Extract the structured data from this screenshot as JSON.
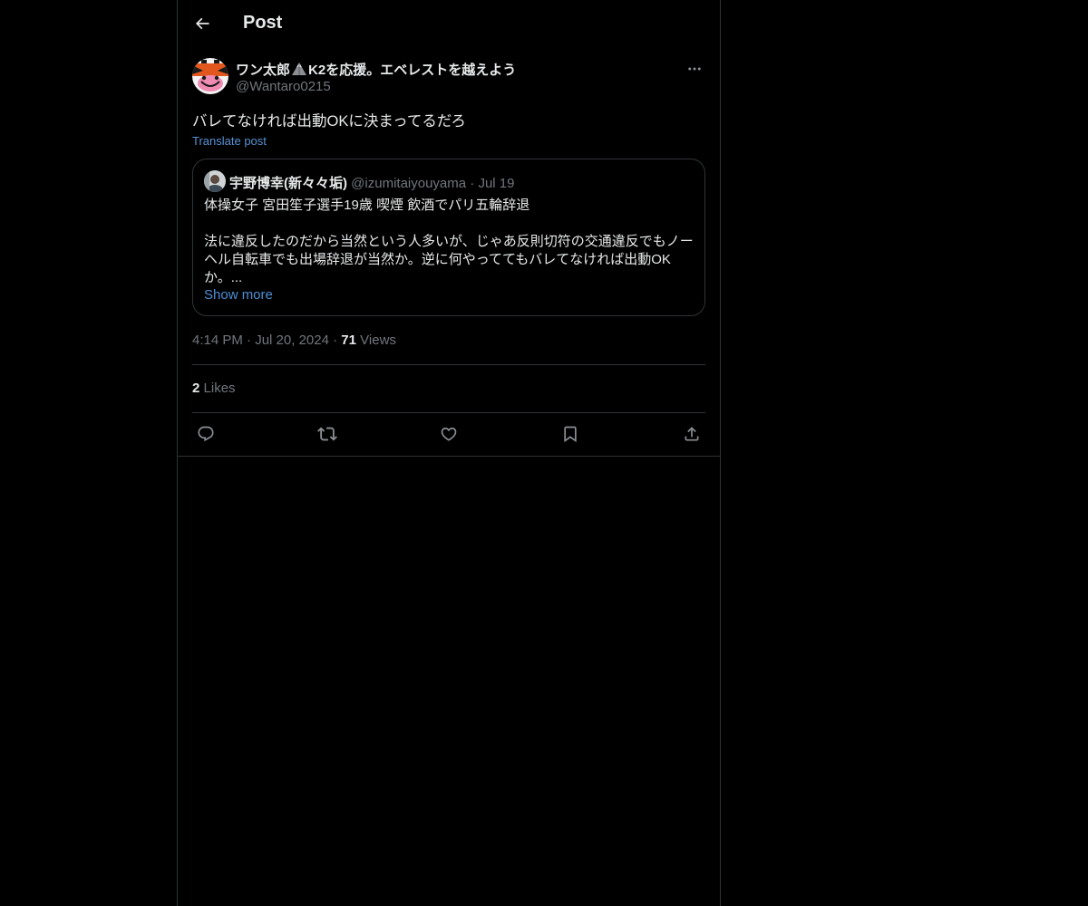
{
  "header": {
    "title": "Post"
  },
  "post": {
    "author": {
      "name_prefix": "ワン太郎",
      "name_suffix": "K2を応援。エベレストを越えよう",
      "handle": "@Wantaro0215"
    },
    "text": "バレてなければ出動OKに決まってるだろ",
    "translate_label": "Translate post",
    "quote": {
      "author_name": "宇野博幸(新々々垢)",
      "handle": "@izumitaiyouyama",
      "separator": "·",
      "date": "Jul 19",
      "line1": "体操女子 宮田笙子選手19歳 喫煙 飲酒でパリ五輪辞退",
      "line2": "法に違反したのだから当然という人多いが、じゃあ反則切符の交通違反でもノーヘル自転車でも出場辞退が当然か。逆に何やっててもバレてなければ出動OKか。...",
      "show_more": "Show more"
    },
    "meta": {
      "time": "4:14 PM",
      "date": "Jul 20, 2024",
      "separator": "·",
      "views_count": "71",
      "views_label": "Views"
    },
    "stats": {
      "likes_count": "2",
      "likes_label": "Likes"
    }
  },
  "colors": {
    "background": "#000000",
    "border": "#2f3336",
    "text_primary": "#e7e9ea",
    "text_secondary": "#71767b",
    "link": "#5891d4"
  },
  "icons": {
    "back": "arrow-left-icon",
    "more": "more-horizontal-icon",
    "reply": "reply-icon",
    "repost": "repost-icon",
    "like": "heart-icon",
    "bookmark": "bookmark-icon",
    "share": "share-icon"
  }
}
